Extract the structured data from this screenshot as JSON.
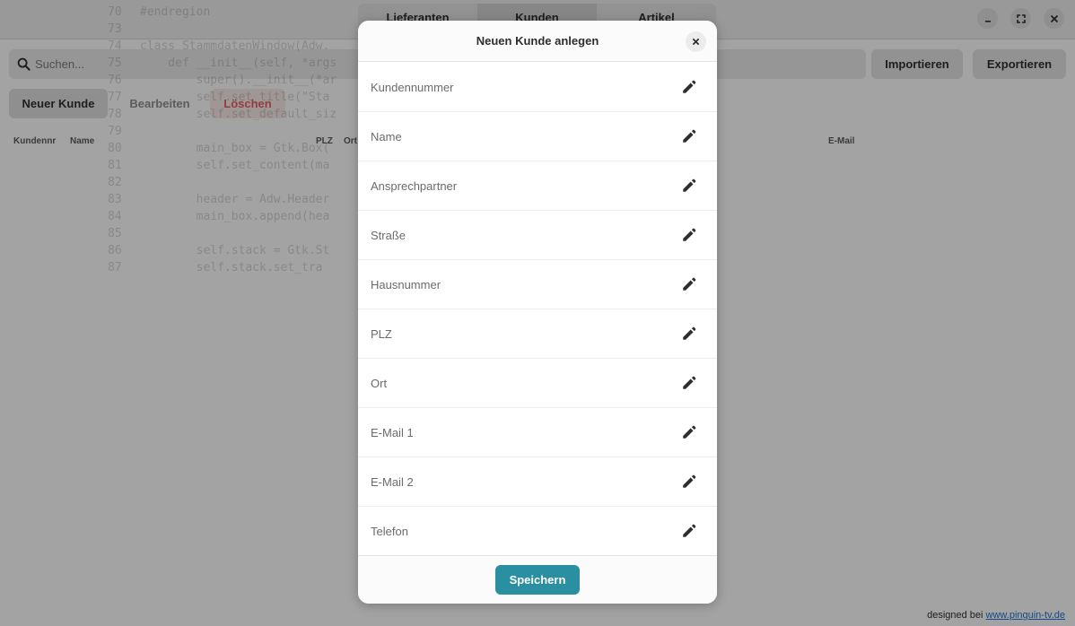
{
  "window": {
    "tabs": [
      {
        "label": "Lieferanten"
      },
      {
        "label": "Kunden"
      },
      {
        "label": "Artikel"
      }
    ],
    "controls": {
      "minimize": "minimize-icon",
      "maximize": "maximize-icon",
      "close": "close-icon"
    }
  },
  "search": {
    "placeholder": "Suchen..."
  },
  "toolbar": {
    "import_label": "Importieren",
    "export_label": "Exportieren"
  },
  "actions": {
    "new_label": "Neuer Kunde",
    "edit_label": "Bearbeiten",
    "delete_label": "Löschen"
  },
  "table": {
    "columns": [
      "Kundennr",
      "Name",
      "PLZ",
      "Ort",
      "E-Mail"
    ]
  },
  "code_overlay": [
    {
      "ln": "70",
      "text": "#endregion"
    },
    {
      "ln": "73",
      "text": ""
    },
    {
      "ln": "74",
      "text": "class StammdatenWindow(Adw."
    },
    {
      "ln": "75",
      "text": "    def __init__(self, *args"
    },
    {
      "ln": "76",
      "text": "        super().__init__(*ar"
    },
    {
      "ln": "77",
      "text": "        self.set_title(\"Sta"
    },
    {
      "ln": "78",
      "text": "        self.set_default_siz"
    },
    {
      "ln": "79",
      "text": ""
    },
    {
      "ln": "80",
      "text": "        main_box = Gtk.Box("
    },
    {
      "ln": "81",
      "text": "        self.set_content(ma"
    },
    {
      "ln": "82",
      "text": ""
    },
    {
      "ln": "83",
      "text": "        header = Adw.Header"
    },
    {
      "ln": "84",
      "text": "        main_box.append(hea"
    },
    {
      "ln": "85",
      "text": ""
    },
    {
      "ln": "86",
      "text": "        self.stack = Gtk.St"
    },
    {
      "ln": "87",
      "text": "        self.stack.set_tra"
    }
  ],
  "dialog": {
    "title": "Neuen Kunde anlegen",
    "fields": [
      {
        "label": "Kundennummer"
      },
      {
        "label": "Name"
      },
      {
        "label": "Ansprechpartner"
      },
      {
        "label": "Straße"
      },
      {
        "label": "Hausnummer"
      },
      {
        "label": "PLZ"
      },
      {
        "label": "Ort"
      },
      {
        "label": "E-Mail 1"
      },
      {
        "label": "E-Mail 2"
      },
      {
        "label": "Telefon"
      }
    ],
    "save_label": "Speichern"
  },
  "footer": {
    "prefix": "designed bei ",
    "link_text": "www.pinguin-tv.de"
  },
  "colors": {
    "accent": "#2a8fa0",
    "danger": "#e01b24",
    "link": "#1c71d8"
  }
}
